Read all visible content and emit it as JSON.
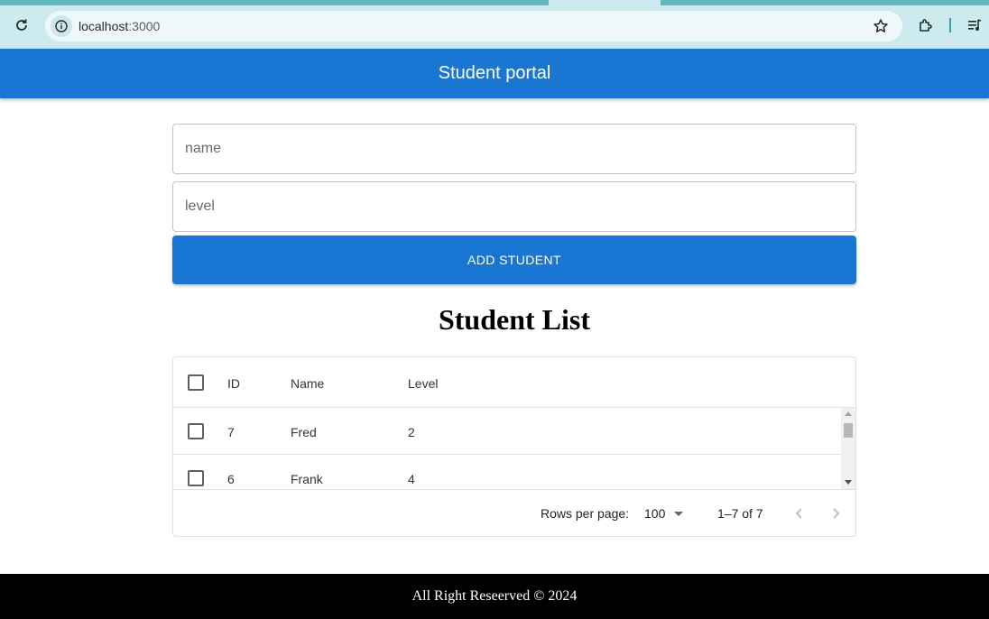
{
  "browser": {
    "url_host": "localhost",
    "url_port": ":3000",
    "icons": {
      "reload": "reload-icon",
      "site_info": "info-icon",
      "bookmark": "star-icon",
      "extensions": "puzzle-icon",
      "media": "media-control-icon"
    }
  },
  "appbar": {
    "title": "Student portal",
    "color": "#1976d2"
  },
  "form": {
    "name_placeholder": "name",
    "level_placeholder": "level",
    "name_value": "",
    "level_value": "",
    "add_button_label": "ADD STUDENT"
  },
  "list_title": "Student List",
  "grid": {
    "columns": [
      "ID",
      "Name",
      "Level"
    ],
    "rows": [
      {
        "id": "7",
        "name": "Fred",
        "level": "2"
      },
      {
        "id": "6",
        "name": "Frank",
        "level": "4"
      }
    ],
    "footer": {
      "rows_per_page_label": "Rows per page:",
      "rows_per_page_value": "100",
      "range": "1–7 of 7"
    }
  },
  "footer_text": "All Right Reseerved © 2024"
}
